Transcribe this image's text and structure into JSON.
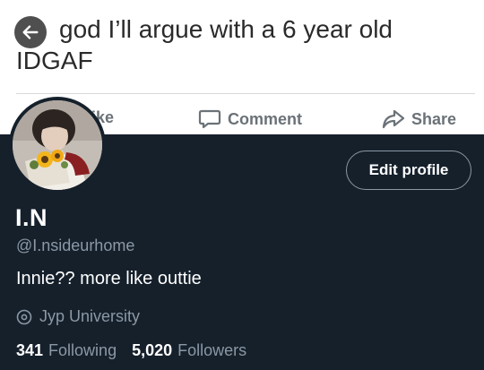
{
  "post": {
    "text": "god I’ll argue with a 6 year old IDGAF",
    "actions": {
      "like": "ike",
      "comment": "Comment",
      "share": "Share"
    }
  },
  "profile": {
    "display_name": "I.N",
    "handle": "@I.nsideurhome",
    "bio": "Innie?? more like outtie",
    "location": "Jyp University",
    "following_count": "341",
    "following_label": "Following",
    "followers_count": "5,020",
    "followers_label": "Followers",
    "edit_button": "Edit profile"
  },
  "colors": {
    "background": "#15202b",
    "secondary_text": "#8b98a5",
    "primary_text": "#ffffff"
  },
  "icons": {
    "back": "arrow-left-icon",
    "comment": "speech-bubble-icon",
    "share": "share-arrow-icon",
    "location": "map-pin-icon"
  }
}
